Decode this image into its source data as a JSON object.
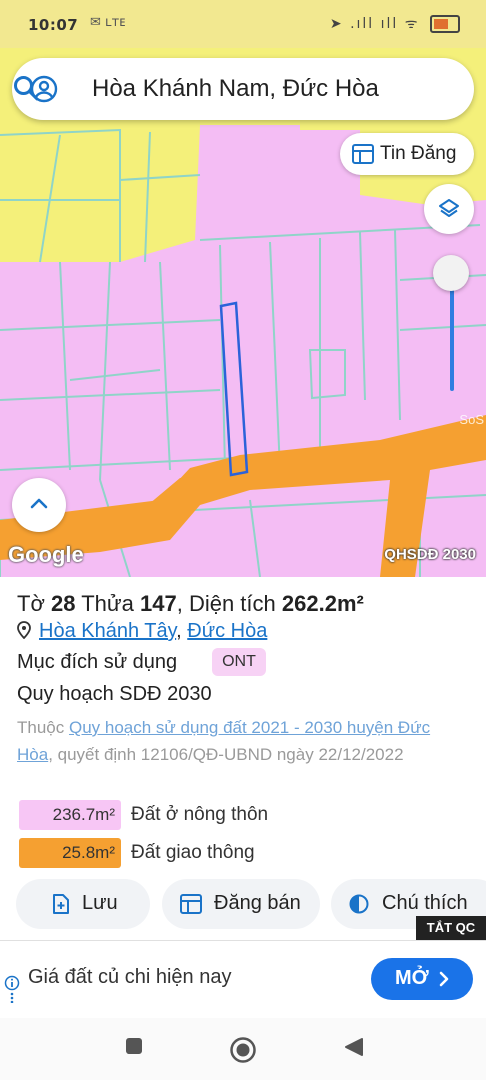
{
  "status_bar": {
    "time": "10:07",
    "left_icons": "✉ ʟᴛᴇ",
    "right_icons": "➤ .ıll ıll ᯤ"
  },
  "search": {
    "query": "Hòa Khánh Nam, Đức Hòa",
    "avatar_icon": "account-circle-icon",
    "search_icon": "search-icon"
  },
  "map": {
    "tin_dang_label": "Tin Đăng",
    "google_logo": "Google",
    "layer_label": "QHSDĐ 2030",
    "watermark": "SoS",
    "colors": {
      "residential": "#f4bdf4",
      "agricultural": "#f4f07a",
      "road": "#f5a031",
      "parcel_line": "#8fd4c8",
      "selected_parcel": "#2b62d9"
    }
  },
  "parcel": {
    "to_label": "Tờ",
    "to_number": "28",
    "thua_label": "Thửa",
    "thua_number": "147",
    "area_label": "Diện tích",
    "area_value": "262.2m²",
    "ward": "Hòa Khánh Tây",
    "separator": ",",
    "district": "Đức Hòa",
    "purpose_label": "Mục đích sử dụng",
    "purpose_code": "ONT",
    "plan_title": "Quy hoạch SDĐ 2030",
    "desc_prefix": "Thuộc",
    "desc_link": "Quy hoạch sử dụng đất 2021 - 2030 huyện Đức Hòa",
    "desc_suffix": ", quyết định 12106/QĐ-UBND ngày 22/12/2022"
  },
  "legend": [
    {
      "area": "236.7m²",
      "label": "Đất ở nông thôn",
      "color": "#f7c6f5"
    },
    {
      "area": "25.8m²",
      "label": "Đất giao thông",
      "color": "#f5a031"
    }
  ],
  "actions": {
    "save": "Lưu",
    "sell": "Đăng bán",
    "notes": "Chú thích"
  },
  "ad": {
    "close_label": "TẮT QC",
    "text": "Giá đất củ chi hiện nay",
    "button": "MỞ"
  }
}
